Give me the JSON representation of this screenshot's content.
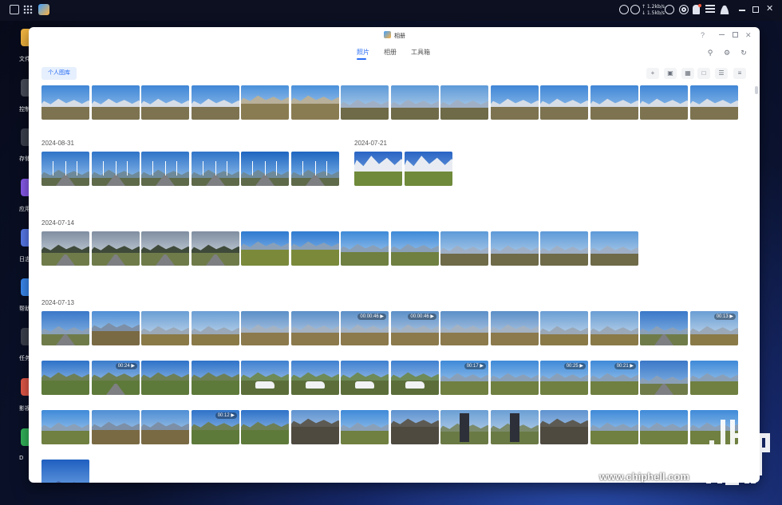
{
  "system_bar": {
    "network": {
      "upload": "↑ 1.2kb/s",
      "download": "↓ 1.5kb/s"
    },
    "icons": [
      "window-icon",
      "apps-grid-icon",
      "app-taskbar-icon",
      "gauge-icon",
      "gauge2-icon",
      "globe-icon",
      "target-icon",
      "bell-icon",
      "sliders-icon",
      "user-icon",
      "minimize-icon",
      "maximize-icon",
      "close-icon"
    ],
    "notification_color": "#ff5a3c"
  },
  "desktop": {
    "items": [
      {
        "label": "文件",
        "color": "#f2b540"
      },
      {
        "label": "控制",
        "color": "#4a4f5c"
      },
      {
        "label": "存储",
        "color": "#3d4250"
      },
      {
        "label": "应用",
        "color": "#8a5cf0"
      },
      {
        "label": "日志",
        "color": "#5a7cf0"
      },
      {
        "label": "帮助",
        "color": "#3b8cf5"
      },
      {
        "label": "任务",
        "color": "#3d4250"
      },
      {
        "label": "影视",
        "color": "#e85a4a"
      },
      {
        "label": "D",
        "color": "#33b85c"
      }
    ]
  },
  "window": {
    "title": "相册",
    "help": "?",
    "tabs": [
      "照片",
      "相册",
      "工具箱"
    ],
    "active_tab": 0,
    "chip_label": "个人图库",
    "toolbar_icons": [
      "add-icon",
      "face-icon",
      "grid-view-icon",
      "folder-icon",
      "list-icon",
      "filter-icon"
    ],
    "header_icons": [
      "search-icon",
      "settings-icon",
      "refresh-icon"
    ],
    "accent": "#2a6df4"
  },
  "sections": [
    {
      "date": "",
      "thumbs": [
        "p",
        "p",
        "p",
        "p",
        "m",
        "m",
        "h",
        "h",
        "h",
        "p",
        "p",
        "p",
        "p",
        "p"
      ]
    },
    {
      "date": "2024-08-31",
      "thumbs": [
        "w",
        "w",
        "w",
        "w",
        "w2",
        "w2"
      ]
    },
    {
      "date": "2024-07-21",
      "thumbs": [
        "a",
        "a"
      ]
    },
    {
      "date": "2024-07-14",
      "thumbs": [
        "c",
        "c",
        "c",
        "c",
        "f",
        "f",
        "g",
        "g",
        "h",
        "h",
        "h",
        "h"
      ]
    },
    {
      "date": "2024-07-13",
      "rows": [
        [
          [
            "s",
            ""
          ],
          [
            "k",
            ""
          ],
          [
            "v",
            ""
          ],
          [
            "v",
            ""
          ],
          [
            "l",
            ""
          ],
          [
            "l",
            ""
          ],
          [
            "l",
            "00:00:46"
          ],
          [
            "l",
            "00:00:46"
          ],
          [
            "l",
            ""
          ],
          [
            "l",
            ""
          ],
          [
            "v",
            ""
          ],
          [
            "v",
            ""
          ],
          [
            "s",
            ""
          ],
          [
            "v",
            "00:13"
          ]
        ],
        [
          [
            "b",
            ""
          ],
          [
            "r",
            "00:24"
          ],
          [
            "b",
            ""
          ],
          [
            "b",
            ""
          ],
          [
            "cr",
            ""
          ],
          [
            "cr",
            ""
          ],
          [
            "cr",
            ""
          ],
          [
            "cr",
            ""
          ],
          [
            "g",
            "00:17"
          ],
          [
            "g",
            ""
          ],
          [
            "g",
            "00:25"
          ],
          [
            "g",
            "00:21"
          ],
          [
            "s",
            ""
          ],
          [
            "g",
            ""
          ]
        ],
        [
          [
            "g",
            ""
          ],
          [
            "k",
            ""
          ],
          [
            "k",
            ""
          ],
          [
            "b",
            "00:12"
          ],
          [
            "b",
            ""
          ],
          [
            "rk",
            ""
          ],
          [
            "g",
            ""
          ],
          [
            "rk",
            ""
          ],
          [
            "st",
            ""
          ],
          [
            "st",
            ""
          ],
          [
            "rk",
            ""
          ],
          [
            "g",
            ""
          ],
          [
            "g",
            ""
          ],
          [
            "g",
            ""
          ]
        ],
        [
          [
            "p2",
            ""
          ]
        ]
      ]
    }
  ],
  "watermark": "www.chiphell.com"
}
